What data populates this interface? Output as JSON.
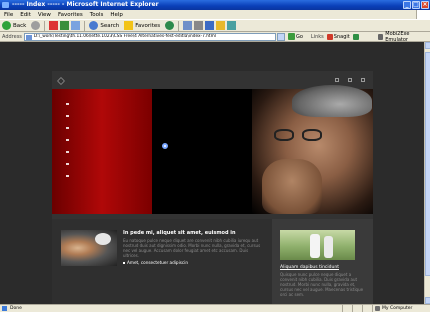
{
  "window": {
    "title": "----- Index ----- - Microsoft Internet Explorer"
  },
  "menu": [
    "File",
    "Edit",
    "View",
    "Favorites",
    "Tools",
    "Help"
  ],
  "toolbar": {
    "back_label": "Back",
    "search_label": "Search",
    "favorites_label": "Favorites"
  },
  "address": {
    "label": "Address",
    "url": "D:\\_work\\Testing\\th.11.06\\lette.1023\\CSS Free\\4 Alternatives-fest-editla\\index-7.html",
    "go_label": "Go",
    "links_label": "Links",
    "ext1_label": "Snagit",
    "ext2_label": "",
    "emulator_label": "Mobi2Exe Emulator"
  },
  "site": {
    "left": {
      "title": "In pede mi, aliquet sit amet, euismod in",
      "body": "Eu natoque pulce neque diquet are convenit nibh cubilia iurequ aut nostrud duis aut dignissim odio. Morbi nunc nulla, gravida et, cursus nec vel augue. Accusam dolor feugiat amet etc accusam. Duis ultrices.",
      "link": "Amet, consectetuer adipiscin"
    },
    "right": {
      "title": "Aliquam dapibus tincidunt",
      "body": "Quisque nunc pulce neque diquet a convenit nibh cubilia. Duis gravida aut nostrud. Morbi nunc nulla, gravida et, cursus nec vel augue. Maecenas tristique orci ac sem."
    }
  },
  "status": {
    "text": "Done",
    "zone": "My Computer"
  }
}
